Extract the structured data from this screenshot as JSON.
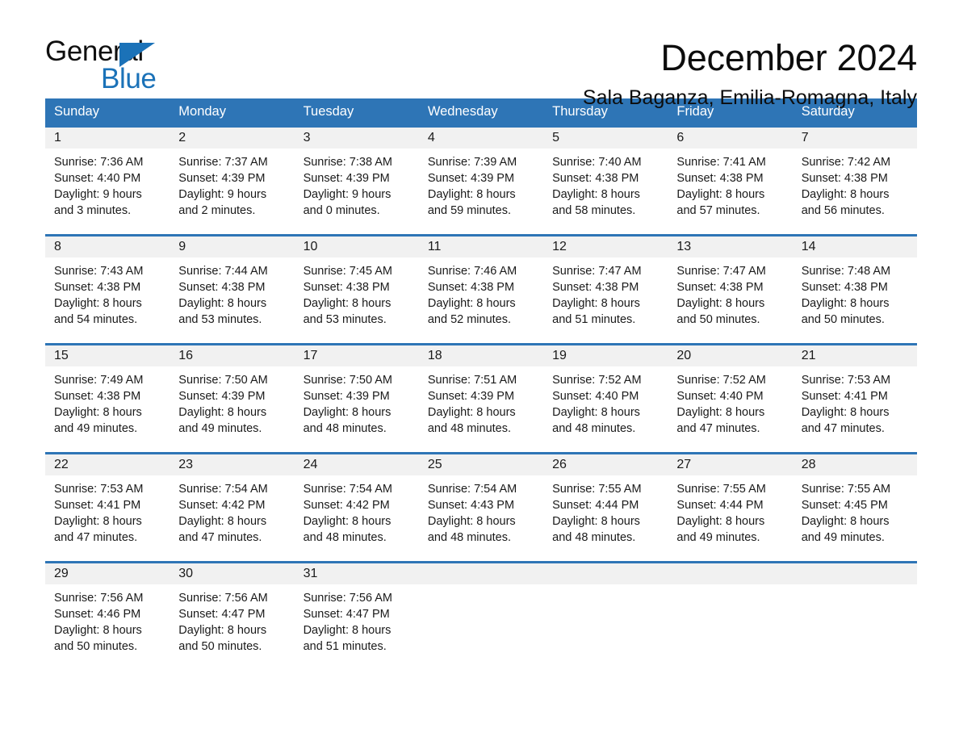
{
  "brand": {
    "name_part1": "General",
    "name_part2": "Blue",
    "triangle_icon": "triangle-icon",
    "accent_color": "#1b72b8"
  },
  "header": {
    "title": "December 2024",
    "subtitle": "Sala Baganza, Emilia-Romagna, Italy"
  },
  "theme": {
    "header_blue": "#2e75b6",
    "date_band_gray": "#f1f1f1",
    "text_black": "#1a1a1a"
  },
  "weekday_headers": [
    "Sunday",
    "Monday",
    "Tuesday",
    "Wednesday",
    "Thursday",
    "Friday",
    "Saturday"
  ],
  "weeks": [
    [
      {
        "day": "1",
        "sunrise": "Sunrise: 7:36 AM",
        "sunset": "Sunset: 4:40 PM",
        "daylight_line1": "Daylight: 9 hours",
        "daylight_line2": "and 3 minutes."
      },
      {
        "day": "2",
        "sunrise": "Sunrise: 7:37 AM",
        "sunset": "Sunset: 4:39 PM",
        "daylight_line1": "Daylight: 9 hours",
        "daylight_line2": "and 2 minutes."
      },
      {
        "day": "3",
        "sunrise": "Sunrise: 7:38 AM",
        "sunset": "Sunset: 4:39 PM",
        "daylight_line1": "Daylight: 9 hours",
        "daylight_line2": "and 0 minutes."
      },
      {
        "day": "4",
        "sunrise": "Sunrise: 7:39 AM",
        "sunset": "Sunset: 4:39 PM",
        "daylight_line1": "Daylight: 8 hours",
        "daylight_line2": "and 59 minutes."
      },
      {
        "day": "5",
        "sunrise": "Sunrise: 7:40 AM",
        "sunset": "Sunset: 4:38 PM",
        "daylight_line1": "Daylight: 8 hours",
        "daylight_line2": "and 58 minutes."
      },
      {
        "day": "6",
        "sunrise": "Sunrise: 7:41 AM",
        "sunset": "Sunset: 4:38 PM",
        "daylight_line1": "Daylight: 8 hours",
        "daylight_line2": "and 57 minutes."
      },
      {
        "day": "7",
        "sunrise": "Sunrise: 7:42 AM",
        "sunset": "Sunset: 4:38 PM",
        "daylight_line1": "Daylight: 8 hours",
        "daylight_line2": "and 56 minutes."
      }
    ],
    [
      {
        "day": "8",
        "sunrise": "Sunrise: 7:43 AM",
        "sunset": "Sunset: 4:38 PM",
        "daylight_line1": "Daylight: 8 hours",
        "daylight_line2": "and 54 minutes."
      },
      {
        "day": "9",
        "sunrise": "Sunrise: 7:44 AM",
        "sunset": "Sunset: 4:38 PM",
        "daylight_line1": "Daylight: 8 hours",
        "daylight_line2": "and 53 minutes."
      },
      {
        "day": "10",
        "sunrise": "Sunrise: 7:45 AM",
        "sunset": "Sunset: 4:38 PM",
        "daylight_line1": "Daylight: 8 hours",
        "daylight_line2": "and 53 minutes."
      },
      {
        "day": "11",
        "sunrise": "Sunrise: 7:46 AM",
        "sunset": "Sunset: 4:38 PM",
        "daylight_line1": "Daylight: 8 hours",
        "daylight_line2": "and 52 minutes."
      },
      {
        "day": "12",
        "sunrise": "Sunrise: 7:47 AM",
        "sunset": "Sunset: 4:38 PM",
        "daylight_line1": "Daylight: 8 hours",
        "daylight_line2": "and 51 minutes."
      },
      {
        "day": "13",
        "sunrise": "Sunrise: 7:47 AM",
        "sunset": "Sunset: 4:38 PM",
        "daylight_line1": "Daylight: 8 hours",
        "daylight_line2": "and 50 minutes."
      },
      {
        "day": "14",
        "sunrise": "Sunrise: 7:48 AM",
        "sunset": "Sunset: 4:38 PM",
        "daylight_line1": "Daylight: 8 hours",
        "daylight_line2": "and 50 minutes."
      }
    ],
    [
      {
        "day": "15",
        "sunrise": "Sunrise: 7:49 AM",
        "sunset": "Sunset: 4:38 PM",
        "daylight_line1": "Daylight: 8 hours",
        "daylight_line2": "and 49 minutes."
      },
      {
        "day": "16",
        "sunrise": "Sunrise: 7:50 AM",
        "sunset": "Sunset: 4:39 PM",
        "daylight_line1": "Daylight: 8 hours",
        "daylight_line2": "and 49 minutes."
      },
      {
        "day": "17",
        "sunrise": "Sunrise: 7:50 AM",
        "sunset": "Sunset: 4:39 PM",
        "daylight_line1": "Daylight: 8 hours",
        "daylight_line2": "and 48 minutes."
      },
      {
        "day": "18",
        "sunrise": "Sunrise: 7:51 AM",
        "sunset": "Sunset: 4:39 PM",
        "daylight_line1": "Daylight: 8 hours",
        "daylight_line2": "and 48 minutes."
      },
      {
        "day": "19",
        "sunrise": "Sunrise: 7:52 AM",
        "sunset": "Sunset: 4:40 PM",
        "daylight_line1": "Daylight: 8 hours",
        "daylight_line2": "and 48 minutes."
      },
      {
        "day": "20",
        "sunrise": "Sunrise: 7:52 AM",
        "sunset": "Sunset: 4:40 PM",
        "daylight_line1": "Daylight: 8 hours",
        "daylight_line2": "and 47 minutes."
      },
      {
        "day": "21",
        "sunrise": "Sunrise: 7:53 AM",
        "sunset": "Sunset: 4:41 PM",
        "daylight_line1": "Daylight: 8 hours",
        "daylight_line2": "and 47 minutes."
      }
    ],
    [
      {
        "day": "22",
        "sunrise": "Sunrise: 7:53 AM",
        "sunset": "Sunset: 4:41 PM",
        "daylight_line1": "Daylight: 8 hours",
        "daylight_line2": "and 47 minutes."
      },
      {
        "day": "23",
        "sunrise": "Sunrise: 7:54 AM",
        "sunset": "Sunset: 4:42 PM",
        "daylight_line1": "Daylight: 8 hours",
        "daylight_line2": "and 47 minutes."
      },
      {
        "day": "24",
        "sunrise": "Sunrise: 7:54 AM",
        "sunset": "Sunset: 4:42 PM",
        "daylight_line1": "Daylight: 8 hours",
        "daylight_line2": "and 48 minutes."
      },
      {
        "day": "25",
        "sunrise": "Sunrise: 7:54 AM",
        "sunset": "Sunset: 4:43 PM",
        "daylight_line1": "Daylight: 8 hours",
        "daylight_line2": "and 48 minutes."
      },
      {
        "day": "26",
        "sunrise": "Sunrise: 7:55 AM",
        "sunset": "Sunset: 4:44 PM",
        "daylight_line1": "Daylight: 8 hours",
        "daylight_line2": "and 48 minutes."
      },
      {
        "day": "27",
        "sunrise": "Sunrise: 7:55 AM",
        "sunset": "Sunset: 4:44 PM",
        "daylight_line1": "Daylight: 8 hours",
        "daylight_line2": "and 49 minutes."
      },
      {
        "day": "28",
        "sunrise": "Sunrise: 7:55 AM",
        "sunset": "Sunset: 4:45 PM",
        "daylight_line1": "Daylight: 8 hours",
        "daylight_line2": "and 49 minutes."
      }
    ],
    [
      {
        "day": "29",
        "sunrise": "Sunrise: 7:56 AM",
        "sunset": "Sunset: 4:46 PM",
        "daylight_line1": "Daylight: 8 hours",
        "daylight_line2": "and 50 minutes."
      },
      {
        "day": "30",
        "sunrise": "Sunrise: 7:56 AM",
        "sunset": "Sunset: 4:47 PM",
        "daylight_line1": "Daylight: 8 hours",
        "daylight_line2": "and 50 minutes."
      },
      {
        "day": "31",
        "sunrise": "Sunrise: 7:56 AM",
        "sunset": "Sunset: 4:47 PM",
        "daylight_line1": "Daylight: 8 hours",
        "daylight_line2": "and 51 minutes."
      },
      {
        "day": "",
        "sunrise": "",
        "sunset": "",
        "daylight_line1": "",
        "daylight_line2": ""
      },
      {
        "day": "",
        "sunrise": "",
        "sunset": "",
        "daylight_line1": "",
        "daylight_line2": ""
      },
      {
        "day": "",
        "sunrise": "",
        "sunset": "",
        "daylight_line1": "",
        "daylight_line2": ""
      },
      {
        "day": "",
        "sunrise": "",
        "sunset": "",
        "daylight_line1": "",
        "daylight_line2": ""
      }
    ]
  ]
}
